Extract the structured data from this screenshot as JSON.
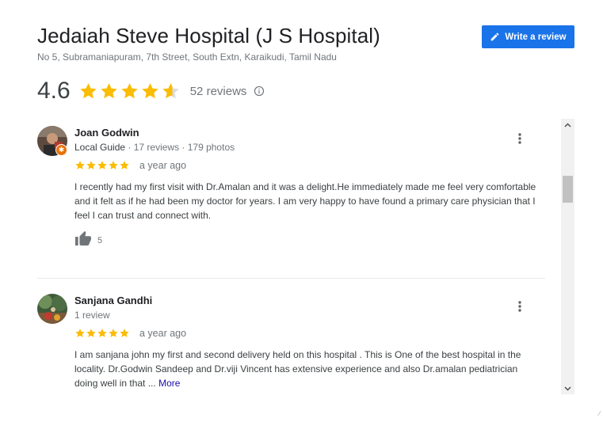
{
  "place": {
    "title": "Jedaiah Steve Hospital (J S Hospital)",
    "address": "No 5, Subramaniapuram, 7th Street, South Extn, Karaikudi, Tamil Nadu"
  },
  "actions": {
    "write_review_label": "Write a review",
    "write_review_icon": "pencil-icon"
  },
  "rating": {
    "value": "4.6",
    "stars": 4.6,
    "star_color": "#fbbc04",
    "count_label": "52 reviews",
    "info_icon": "info-icon"
  },
  "colors": {
    "accent": "#1a73e8",
    "star": "#fbbc04",
    "link": "#1a0dab",
    "local_guide_badge": "#e8710a"
  },
  "reviews": [
    {
      "name": "Joan Godwin",
      "badge": "Local Guide",
      "stats": " · 17 reviews · 179 photos",
      "stars": 5,
      "date": "a year ago",
      "text": "I recently had my first visit with Dr.Amalan  and it was a delight.He immediately made me feel very comfortable and it felt as if he had been my doctor for years. I am very happy to have found a primary care physician that I feel I can trust and connect with.",
      "likes": "5",
      "like_icon": "thumbs-up-icon",
      "menu_icon": "more-vert-icon"
    },
    {
      "name": "Sanjana Gandhi",
      "stats": "1 review",
      "stars": 5,
      "date": "a year ago",
      "text": "I am sanjana john my first and second delivery held on this hospital . This is One of the best hospital in the locality. Dr.Godwin Sandeep and Dr.viji Vincent has extensive experience and also Dr.amalan pediatrician doing well in that ...",
      "more_label": "More",
      "menu_icon": "more-vert-icon"
    }
  ],
  "scrollbar": {
    "thumb_position": 0.2
  },
  "corner_mark": "⁄"
}
